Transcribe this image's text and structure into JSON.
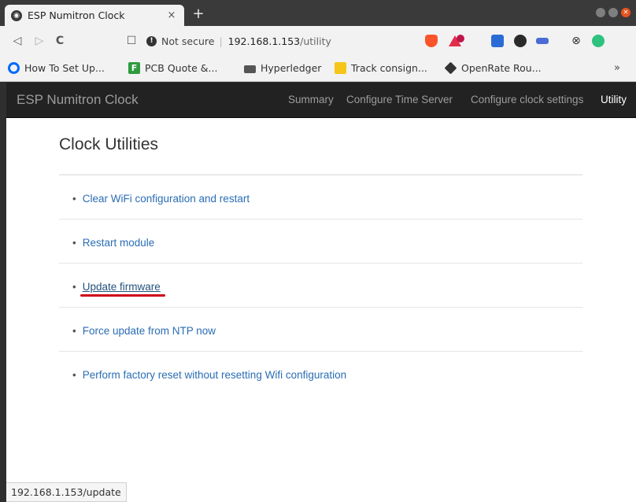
{
  "browser": {
    "tab": {
      "title": "ESP Numitron Clock",
      "close": "×"
    },
    "new_tab": "+",
    "nav": {
      "back": "◁",
      "forward": "▷",
      "reload": "C",
      "bookmark": "☐"
    },
    "address": {
      "info_icon": "!",
      "security_label": "Not secure",
      "separator": "|",
      "host": "192.168.1.153",
      "path": "/utility"
    },
    "bookmarks": [
      {
        "label": "How To Set Up...",
        "icon": "digitalocean-icon"
      },
      {
        "label": "PCB Quote &...",
        "icon": "pcb-icon",
        "icon_text": "F"
      },
      {
        "label": "Hyperledger",
        "icon": "folder-icon"
      },
      {
        "label": "Track consign...",
        "icon": "track-icon"
      },
      {
        "label": "OpenRate Rou...",
        "icon": "openrate-icon"
      }
    ],
    "bookmarks_more": "»",
    "status_url": "192.168.1.153/update",
    "colors": {
      "accent_close": "#e95420",
      "brave": "#fb542b"
    }
  },
  "page": {
    "navbar": {
      "brand": "ESP Numitron Clock",
      "links": [
        "Summary",
        "Configure Time Server",
        "Configure clock settings",
        "Utility"
      ]
    },
    "header": {
      "title": "Clock Utilities"
    },
    "bullet": "•",
    "utilities": [
      "Clear WiFi configuration and restart",
      "Restart module",
      "Update firmware",
      "Force update from NTP now",
      "Perform factory reset without resetting Wifi configuration"
    ],
    "colors": {
      "navbar_bg": "#222222",
      "link": "#337ab7",
      "highlight_underline": "#d0021b"
    }
  }
}
